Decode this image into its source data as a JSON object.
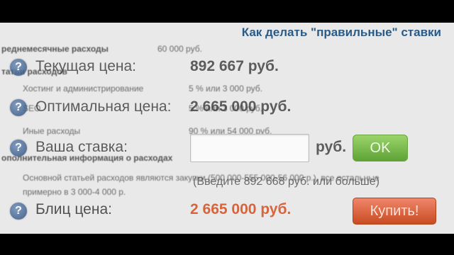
{
  "page_title": "Как делать \"правильные\" ставки",
  "background_table": {
    "monthly_label": "реднемесячные расходы",
    "monthly_value": "60 000 руб.",
    "section_expenses": "татьи расходов",
    "rows": [
      {
        "label": "Хостинг и администрирование",
        "value": "5 % или 3 000 руб."
      },
      {
        "label": "SEO",
        "value": "5 % или 3 000 руб."
      },
      {
        "label": "Иные расходы",
        "value": "90 % или 54 000 руб."
      }
    ],
    "section_info": "ополнительная информация о расходах",
    "info_line1": "Основной статьей расходов являются закупки (500 000-555 000-56 000 р.), все остальные",
    "info_line2": "примерно в 3 000-4 000 р."
  },
  "price_panel": {
    "current_label": "Текущая цена:",
    "current_value": "892 667 руб.",
    "optimal_label": "Оптимальная цена:",
    "optimal_value": "2 665 000 руб.",
    "bid_label": "Ваша ставка:",
    "bid_input_value": "",
    "bid_currency": "руб.",
    "ok_label": "OK",
    "hint": "(Введите 892 668 руб. или больше)",
    "blitz_label": "Блиц цена:",
    "blitz_value": "2 665 000 руб.",
    "buy_label": "Купить!",
    "help_glyph": "?"
  },
  "colors": {
    "title": "#2a5a86",
    "ok_button": "#6fb443",
    "buy_button": "#d9582c",
    "blitz_price": "#d44e1f"
  },
  "icons": [
    "help-icon"
  ]
}
